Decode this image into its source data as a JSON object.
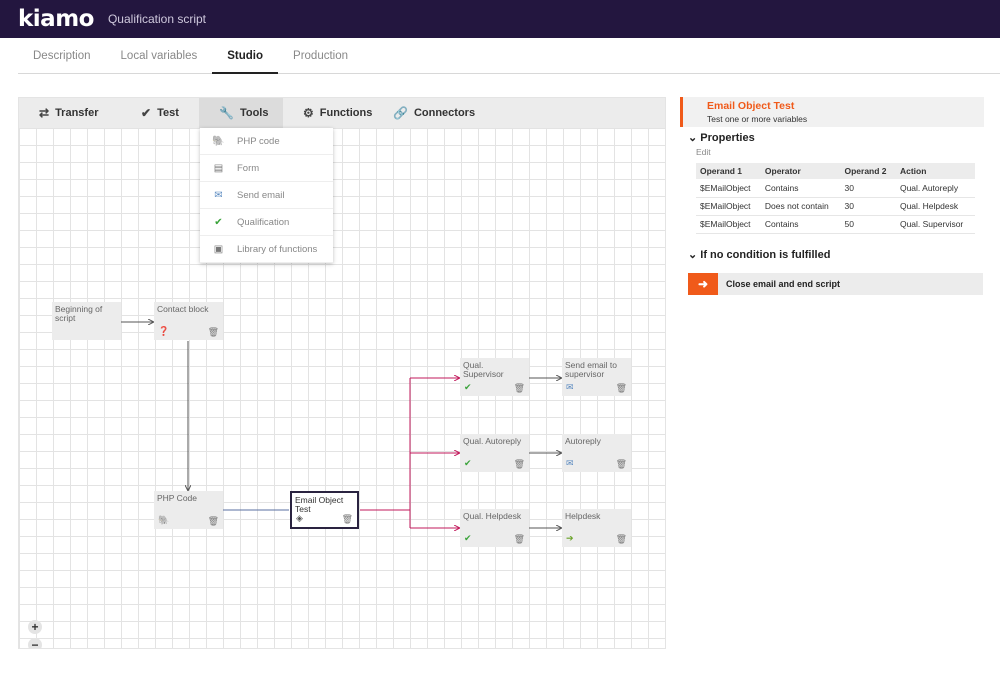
{
  "header": {
    "logo": "kiamo",
    "title": "Qualification script"
  },
  "tabs": [
    "Description",
    "Local variables",
    "Studio",
    "Production"
  ],
  "toolbar": {
    "transfer": "Transfer",
    "test": "Test",
    "tools": "Tools",
    "functions": "Functions",
    "connectors": "Connectors"
  },
  "tools_menu": [
    "PHP code",
    "Form",
    "Send email",
    "Qualification",
    "Library of functions"
  ],
  "nodes": {
    "begin": "Beginning of script",
    "contact": "Contact block",
    "php": "PHP Code",
    "email_test": "Email Object Test",
    "qual_supervisor": "Qual. Supervisor",
    "send_supervisor": "Send email to supervisor",
    "qual_autoreply": "Qual. Autoreply",
    "autoreply": "Autoreply",
    "qual_helpdesk": "Qual. Helpdesk",
    "helpdesk": "Helpdesk"
  },
  "zoom": {
    "in": "+",
    "out": "−"
  },
  "panel": {
    "title": "Email Object Test",
    "subtitle": "Test one or more variables",
    "properties": "Properties",
    "edit": "Edit",
    "columns": [
      "Operand 1",
      "Operator",
      "Operand 2",
      "Action"
    ],
    "rows": [
      [
        "$EMailObject",
        "Contains",
        "30",
        "Qual. Autoreply"
      ],
      [
        "$EMailObject",
        "Does not contain",
        "30",
        "Qual. Helpdesk"
      ],
      [
        "$EMailObject",
        "Contains",
        "50",
        "Qual. Supervisor"
      ]
    ],
    "fallback": "If no condition is fulfilled",
    "fallback_action": "Close email and end script"
  },
  "colors": {
    "header_bg": "#23163f",
    "accent": "#f05a1a",
    "link_red": "#c2185b",
    "link_blue": "#5a6fa0"
  }
}
